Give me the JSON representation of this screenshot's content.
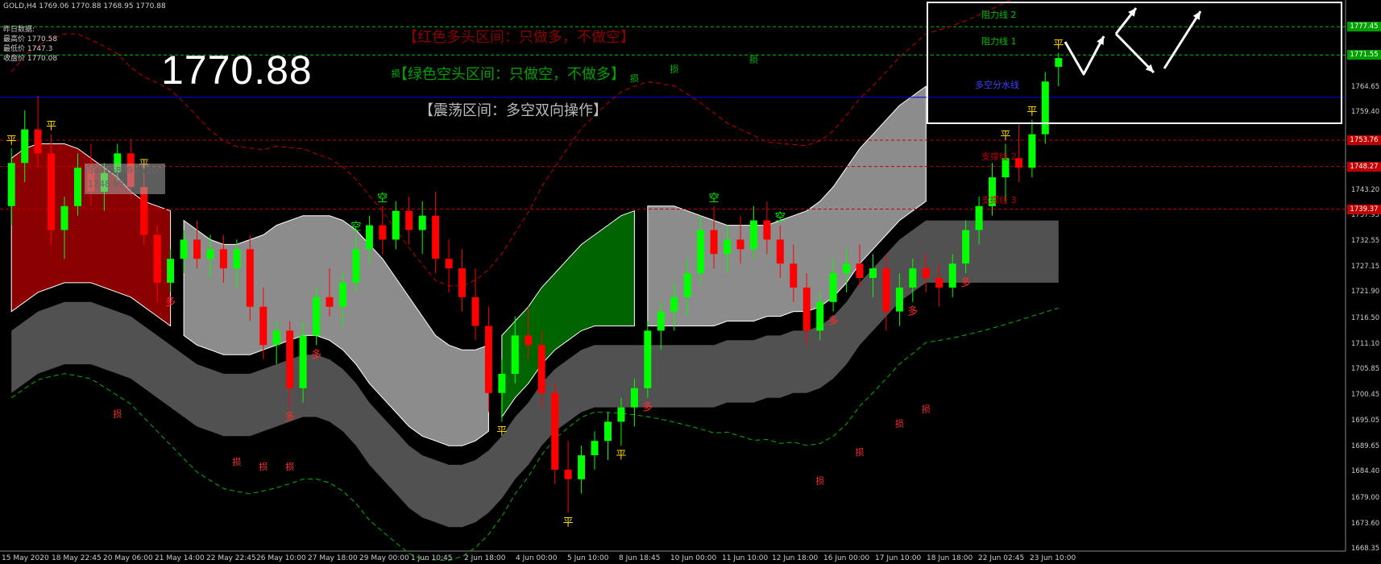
{
  "header": {
    "title": "GOLD,H4  1769.06 1770.88 1768.95 1770.88",
    "yesterday_title": "昨日数据:",
    "high": "最高价 1770.58",
    "low": "最低价 1747.3",
    "close": "收盘价 1770.08"
  },
  "big_price": "1770.88",
  "zones": {
    "red": "【红色多头区间：只做多，不做空】",
    "green": "【绿色空头区间：只做空，不做多】",
    "grey": "【震荡区间：多空双向操作】"
  },
  "level_labels": {
    "resistance2": "阻力线 2",
    "resistance1": "阻力线 1",
    "bull_bear": "多空分水线",
    "support2": "支撑线 2",
    "support3": "支撑线 3"
  },
  "tooltip": {
    "line1": "duo15899+1200",
    "line2": "1748.87"
  },
  "colors": {
    "background": "#000000",
    "bull_candle": "#00ff00",
    "bear_candle": "#ff0000",
    "red_band": "#8b0000",
    "green_band": "#006400",
    "grey_band": "#8c8c8c",
    "dark_band": "#5a5a5a",
    "bull_bear_line": "#0000ff",
    "resistance_line": "#00c000",
    "support_line": "#c00000"
  },
  "chart_data": {
    "type": "candlestick",
    "title": "GOLD,H4",
    "symbol": "GOLD",
    "timeframe": "H4",
    "ohlc_last": {
      "open": 1769.06,
      "high": 1770.88,
      "low": 1768.95,
      "close": 1770.88
    },
    "ylim": [
      1668.0,
      1782.0
    ],
    "y_ticks": [
      "1777.45",
      "1771.55",
      "1764.65",
      "1759.40",
      "1753.76",
      "1748.27",
      "1743.20",
      "1737.95",
      "1732.55",
      "1727.15",
      "1721.90",
      "1716.50",
      "1711.10",
      "1705.85",
      "1700.45",
      "1695.05",
      "1689.65",
      "1684.40",
      "1679.00",
      "1673.60",
      "1668.35"
    ],
    "x_ticks": [
      "15 May 2020",
      "18 May 22:45",
      "20 May 06:00",
      "21 May 14:00",
      "22 May 22:45",
      "26 May 10:00",
      "27 May 18:00",
      "29 May 00:00",
      "1 Jun 10:45",
      "2 Jun 18:00",
      "4 Jun 00:00",
      "5 Jun 10:00",
      "8 Jun 18:45",
      "10 Jun 00:00",
      "11 Jun 10:00",
      "12 Jun 18:00",
      "16 Jun 00:00",
      "17 Jun 10:00",
      "18 Jun 18:00",
      "22 Jun 02:45",
      "23 Jun 10:00"
    ],
    "price_levels": [
      {
        "label": "阻力线 2",
        "value": 1777.45,
        "color": "#00c000",
        "style": "dashed",
        "tag": "1777.45"
      },
      {
        "label": "阻力线 1",
        "value": 1771.55,
        "color": "#00c000",
        "style": "dashed",
        "tag": "1771.55"
      },
      {
        "label": "多空分水线",
        "value": 1762.7,
        "color": "#0000ff",
        "style": "solid",
        "tag": ""
      },
      {
        "label": "",
        "value": 1753.76,
        "color": "#c00000",
        "style": "dashed",
        "tag": "1753.76"
      },
      {
        "label": "支撑线 2",
        "value": 1748.27,
        "color": "#c00000",
        "style": "dashed",
        "tag": "1748.27"
      },
      {
        "label": "支撑线 3",
        "value": 1739.37,
        "color": "#c00000",
        "style": "dashed",
        "tag": "1739.37"
      }
    ],
    "band_phases": [
      {
        "type": "bull",
        "from_index": 0,
        "to_index": 12
      },
      {
        "type": "range",
        "from_index": 13,
        "to_index": 36
      },
      {
        "type": "bear",
        "from_index": 37,
        "to_index": 47
      },
      {
        "type": "range",
        "from_index": 48,
        "to_index": 69
      },
      {
        "type": "bull",
        "from_index": 70,
        "to_index": 79
      }
    ],
    "band_upper": [
      1750,
      1752,
      1753,
      1753,
      1753,
      1752,
      1750,
      1748,
      1746,
      1743,
      1741,
      1740,
      1739,
      1737,
      1735,
      1733,
      1732,
      1732,
      1733,
      1734,
      1736,
      1737,
      1738,
      1738,
      1738,
      1737,
      1735,
      1732,
      1729,
      1725,
      1721,
      1717,
      1713,
      1711,
      1710,
      1710,
      1711,
      1713,
      1716,
      1719,
      1723,
      1726,
      1729,
      1732,
      1734,
      1736,
      1738,
      1739,
      1740,
      1740,
      1740,
      1739,
      1738,
      1737,
      1736,
      1736,
      1736,
      1736,
      1737,
      1738,
      1739,
      1741,
      1744,
      1748,
      1752,
      1755,
      1758,
      1761,
      1763,
      1765
    ],
    "band_lower": [
      1718,
      1720,
      1722,
      1723,
      1724,
      1724,
      1724,
      1723,
      1722,
      1721,
      1719,
      1717,
      1715,
      1713,
      1711,
      1710,
      1709,
      1709,
      1709,
      1710,
      1711,
      1712,
      1713,
      1713,
      1712,
      1710,
      1707,
      1703,
      1700,
      1697,
      1694,
      1692,
      1691,
      1690,
      1690,
      1691,
      1693,
      1696,
      1700,
      1703,
      1707,
      1710,
      1712,
      1714,
      1715,
      1715,
      1715,
      1715,
      1715,
      1715,
      1715,
      1715,
      1715,
      1715,
      1716,
      1716,
      1716,
      1717,
      1717,
      1718,
      1718,
      1719,
      1721,
      1724,
      1728,
      1731,
      1734,
      1737,
      1739,
      1741
    ],
    "candles": [
      {
        "o": 1740,
        "h": 1752,
        "l": 1736,
        "c": 1749
      },
      {
        "o": 1749,
        "h": 1760,
        "l": 1745,
        "c": 1756
      },
      {
        "o": 1756,
        "h": 1763,
        "l": 1748,
        "c": 1751
      },
      {
        "o": 1751,
        "h": 1755,
        "l": 1732,
        "c": 1735
      },
      {
        "o": 1735,
        "h": 1742,
        "l": 1729,
        "c": 1740
      },
      {
        "o": 1740,
        "h": 1751,
        "l": 1738,
        "c": 1748
      },
      {
        "o": 1748,
        "h": 1753,
        "l": 1740,
        "c": 1743
      },
      {
        "o": 1743,
        "h": 1749,
        "l": 1739,
        "c": 1747
      },
      {
        "o": 1747,
        "h": 1753,
        "l": 1745,
        "c": 1751
      },
      {
        "o": 1751,
        "h": 1754,
        "l": 1742,
        "c": 1744
      },
      {
        "o": 1744,
        "h": 1747,
        "l": 1732,
        "c": 1734
      },
      {
        "o": 1734,
        "h": 1736,
        "l": 1720,
        "c": 1724
      },
      {
        "o": 1724,
        "h": 1731,
        "l": 1722,
        "c": 1729
      },
      {
        "o": 1729,
        "h": 1735,
        "l": 1726,
        "c": 1733
      },
      {
        "o": 1733,
        "h": 1737,
        "l": 1727,
        "c": 1729
      },
      {
        "o": 1729,
        "h": 1734,
        "l": 1725,
        "c": 1731
      },
      {
        "o": 1731,
        "h": 1734,
        "l": 1724,
        "c": 1727
      },
      {
        "o": 1727,
        "h": 1733,
        "l": 1723,
        "c": 1731
      },
      {
        "o": 1731,
        "h": 1734,
        "l": 1716,
        "c": 1719
      },
      {
        "o": 1719,
        "h": 1723,
        "l": 1708,
        "c": 1711
      },
      {
        "o": 1711,
        "h": 1716,
        "l": 1707,
        "c": 1714
      },
      {
        "o": 1714,
        "h": 1716,
        "l": 1698,
        "c": 1702
      },
      {
        "o": 1702,
        "h": 1716,
        "l": 1699,
        "c": 1713
      },
      {
        "o": 1713,
        "h": 1723,
        "l": 1711,
        "c": 1721
      },
      {
        "o": 1721,
        "h": 1727,
        "l": 1717,
        "c": 1719
      },
      {
        "o": 1719,
        "h": 1726,
        "l": 1715,
        "c": 1724
      },
      {
        "o": 1724,
        "h": 1734,
        "l": 1722,
        "c": 1731
      },
      {
        "o": 1731,
        "h": 1738,
        "l": 1728,
        "c": 1736
      },
      {
        "o": 1736,
        "h": 1740,
        "l": 1730,
        "c": 1733
      },
      {
        "o": 1733,
        "h": 1741,
        "l": 1731,
        "c": 1739
      },
      {
        "o": 1739,
        "h": 1742,
        "l": 1732,
        "c": 1735
      },
      {
        "o": 1735,
        "h": 1741,
        "l": 1730,
        "c": 1738
      },
      {
        "o": 1738,
        "h": 1743,
        "l": 1726,
        "c": 1729
      },
      {
        "o": 1729,
        "h": 1733,
        "l": 1722,
        "c": 1727
      },
      {
        "o": 1727,
        "h": 1731,
        "l": 1718,
        "c": 1721
      },
      {
        "o": 1721,
        "h": 1727,
        "l": 1712,
        "c": 1715
      },
      {
        "o": 1715,
        "h": 1719,
        "l": 1697,
        "c": 1701
      },
      {
        "o": 1701,
        "h": 1708,
        "l": 1695,
        "c": 1705
      },
      {
        "o": 1705,
        "h": 1717,
        "l": 1703,
        "c": 1713
      },
      {
        "o": 1713,
        "h": 1719,
        "l": 1708,
        "c": 1711
      },
      {
        "o": 1711,
        "h": 1714,
        "l": 1698,
        "c": 1701
      },
      {
        "o": 1701,
        "h": 1703,
        "l": 1682,
        "c": 1685
      },
      {
        "o": 1685,
        "h": 1691,
        "l": 1676,
        "c": 1683
      },
      {
        "o": 1683,
        "h": 1690,
        "l": 1680,
        "c": 1688
      },
      {
        "o": 1688,
        "h": 1693,
        "l": 1685,
        "c": 1691
      },
      {
        "o": 1691,
        "h": 1697,
        "l": 1687,
        "c": 1695
      },
      {
        "o": 1695,
        "h": 1700,
        "l": 1690,
        "c": 1698
      },
      {
        "o": 1698,
        "h": 1704,
        "l": 1694,
        "c": 1702
      },
      {
        "o": 1702,
        "h": 1716,
        "l": 1700,
        "c": 1714
      },
      {
        "o": 1714,
        "h": 1720,
        "l": 1710,
        "c": 1718
      },
      {
        "o": 1718,
        "h": 1724,
        "l": 1714,
        "c": 1721
      },
      {
        "o": 1721,
        "h": 1729,
        "l": 1717,
        "c": 1726
      },
      {
        "o": 1726,
        "h": 1738,
        "l": 1724,
        "c": 1735
      },
      {
        "o": 1735,
        "h": 1740,
        "l": 1727,
        "c": 1730
      },
      {
        "o": 1730,
        "h": 1736,
        "l": 1726,
        "c": 1733
      },
      {
        "o": 1733,
        "h": 1738,
        "l": 1728,
        "c": 1731
      },
      {
        "o": 1731,
        "h": 1740,
        "l": 1729,
        "c": 1737
      },
      {
        "o": 1737,
        "h": 1741,
        "l": 1730,
        "c": 1733
      },
      {
        "o": 1733,
        "h": 1736,
        "l": 1725,
        "c": 1728
      },
      {
        "o": 1728,
        "h": 1732,
        "l": 1720,
        "c": 1723
      },
      {
        "o": 1723,
        "h": 1726,
        "l": 1711,
        "c": 1714
      },
      {
        "o": 1714,
        "h": 1722,
        "l": 1712,
        "c": 1720
      },
      {
        "o": 1720,
        "h": 1729,
        "l": 1718,
        "c": 1726
      },
      {
        "o": 1726,
        "h": 1731,
        "l": 1722,
        "c": 1728
      },
      {
        "o": 1728,
        "h": 1732,
        "l": 1723,
        "c": 1725
      },
      {
        "o": 1725,
        "h": 1730,
        "l": 1721,
        "c": 1727
      },
      {
        "o": 1727,
        "h": 1730,
        "l": 1714,
        "c": 1718
      },
      {
        "o": 1718,
        "h": 1726,
        "l": 1715,
        "c": 1723
      },
      {
        "o": 1723,
        "h": 1729,
        "l": 1720,
        "c": 1727
      },
      {
        "o": 1727,
        "h": 1730,
        "l": 1722,
        "c": 1725
      },
      {
        "o": 1725,
        "h": 1728,
        "l": 1719,
        "c": 1723
      },
      {
        "o": 1723,
        "h": 1730,
        "l": 1721,
        "c": 1728
      },
      {
        "o": 1728,
        "h": 1737,
        "l": 1726,
        "c": 1735
      },
      {
        "o": 1735,
        "h": 1742,
        "l": 1732,
        "c": 1740
      },
      {
        "o": 1740,
        "h": 1749,
        "l": 1738,
        "c": 1746
      },
      {
        "o": 1746,
        "h": 1753,
        "l": 1741,
        "c": 1750
      },
      {
        "o": 1750,
        "h": 1757,
        "l": 1745,
        "c": 1748
      },
      {
        "o": 1748,
        "h": 1758,
        "l": 1746,
        "c": 1755
      },
      {
        "o": 1755,
        "h": 1768,
        "l": 1753,
        "c": 1766
      },
      {
        "o": 1769.06,
        "h": 1772,
        "l": 1765,
        "c": 1770.88
      }
    ],
    "signals": [
      {
        "index": 0,
        "text": "平",
        "side": "top"
      },
      {
        "index": 3,
        "text": "平",
        "side": "top"
      },
      {
        "index": 10,
        "text": "平",
        "side": "top"
      },
      {
        "index": 12,
        "text": "多",
        "side": "bottom"
      },
      {
        "index": 21,
        "text": "多",
        "side": "bottom"
      },
      {
        "index": 23,
        "text": "多",
        "side": "bottom"
      },
      {
        "index": 26,
        "text": "空",
        "side": "top"
      },
      {
        "index": 28,
        "text": "空",
        "side": "top"
      },
      {
        "index": 37,
        "text": "平",
        "side": "bottom"
      },
      {
        "index": 42,
        "text": "平",
        "side": "bottom"
      },
      {
        "index": 46,
        "text": "平",
        "side": "bottom"
      },
      {
        "index": 48,
        "text": "多",
        "side": "bottom"
      },
      {
        "index": 53,
        "text": "空",
        "side": "top"
      },
      {
        "index": 58,
        "text": "空",
        "side": "top"
      },
      {
        "index": 62,
        "text": "多",
        "side": "bottom"
      },
      {
        "index": 68,
        "text": "多",
        "side": "bottom"
      },
      {
        "index": 72,
        "text": "多",
        "side": "bottom"
      },
      {
        "index": 75,
        "text": "平",
        "side": "top"
      },
      {
        "index": 77,
        "text": "平",
        "side": "top"
      },
      {
        "index": 79,
        "text": "平",
        "side": "top"
      }
    ],
    "stop_labels": [
      {
        "index": 8,
        "text": "损",
        "value": 1696
      },
      {
        "index": 17,
        "text": "损",
        "value": 1686
      },
      {
        "index": 19,
        "text": "损",
        "value": 1685
      },
      {
        "index": 21,
        "text": "损",
        "value": 1685
      },
      {
        "index": 29,
        "text": "损",
        "value": 1767
      },
      {
        "index": 47,
        "text": "损",
        "value": 1766
      },
      {
        "index": 50,
        "text": "损",
        "value": 1768
      },
      {
        "index": 56,
        "text": "损",
        "value": 1770
      },
      {
        "index": 61,
        "text": "损",
        "value": 1682
      },
      {
        "index": 64,
        "text": "损",
        "value": 1688
      },
      {
        "index": 67,
        "text": "损",
        "value": 1694
      },
      {
        "index": 69,
        "text": "损",
        "value": 1697
      }
    ]
  }
}
